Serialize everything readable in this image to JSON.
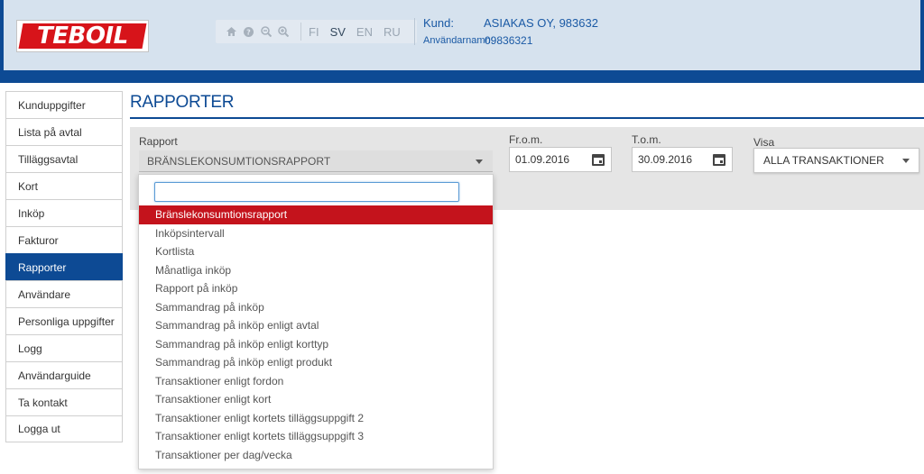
{
  "header": {
    "logo_text": "TEBOIL",
    "toolbar_icons": [
      "home-icon",
      "help-icon",
      "zoom-out-icon",
      "zoom-in-icon"
    ],
    "languages": [
      {
        "code": "FI",
        "active": false
      },
      {
        "code": "SV",
        "active": true
      },
      {
        "code": "EN",
        "active": false
      },
      {
        "code": "RU",
        "active": false
      }
    ],
    "customer_label": "Kund:",
    "customer_value": "ASIAKAS OY, 983632",
    "username_label": "Användarnamn:",
    "username_value": "09836321"
  },
  "sidebar": {
    "items": [
      {
        "label": "Kunduppgifter",
        "active": false
      },
      {
        "label": "Lista på avtal",
        "active": false
      },
      {
        "label": "Tilläggsavtal",
        "active": false
      },
      {
        "label": "Kort",
        "active": false
      },
      {
        "label": "Inköp",
        "active": false
      },
      {
        "label": "Fakturor",
        "active": false
      },
      {
        "label": "Rapporter",
        "active": true
      },
      {
        "label": "Användare",
        "active": false
      },
      {
        "label": "Personliga uppgifter",
        "active": false
      },
      {
        "label": "Logg",
        "active": false
      },
      {
        "label": "Användarguide",
        "active": false
      },
      {
        "label": "Ta kontakt",
        "active": false
      },
      {
        "label": "Logga ut",
        "active": false
      }
    ]
  },
  "main": {
    "title": "RAPPORTER",
    "rapport_label": "Rapport",
    "rapport_value": "BRÄNSLEKONSUMTIONSRAPPORT",
    "from_label": "Fr.o.m.",
    "from_value": "01.09.2016",
    "to_label": "T.o.m.",
    "to_value": "30.09.2016",
    "visa_label": "Visa",
    "visa_value": "ALLA TRANSAKTIONER",
    "dropdown": {
      "search_value": "",
      "items": [
        {
          "label": "Bränslekonsumtionsrapport",
          "selected": true
        },
        {
          "label": "Inköpsintervall",
          "selected": false
        },
        {
          "label": "Kortlista",
          "selected": false
        },
        {
          "label": "Månatliga inköp",
          "selected": false
        },
        {
          "label": "Rapport på inköp",
          "selected": false
        },
        {
          "label": "Sammandrag på inköp",
          "selected": false
        },
        {
          "label": "Sammandrag på inköp enligt avtal",
          "selected": false
        },
        {
          "label": "Sammandrag på inköp enligt korttyp",
          "selected": false
        },
        {
          "label": "Sammandrag på inköp enligt produkt",
          "selected": false
        },
        {
          "label": "Transaktioner enligt fordon",
          "selected": false
        },
        {
          "label": "Transaktioner enligt kort",
          "selected": false
        },
        {
          "label": "Transaktioner enligt kortets tilläggsuppgift 2",
          "selected": false
        },
        {
          "label": "Transaktioner enligt kortets tilläggsuppgift 3",
          "selected": false
        },
        {
          "label": "Transaktioner per dag/vecka",
          "selected": false
        }
      ]
    }
  },
  "colors": {
    "brand_blue": "#0d4a94",
    "brand_red": "#d7141a",
    "selected_red": "#c4131c",
    "header_bg": "#d6e2ee"
  }
}
